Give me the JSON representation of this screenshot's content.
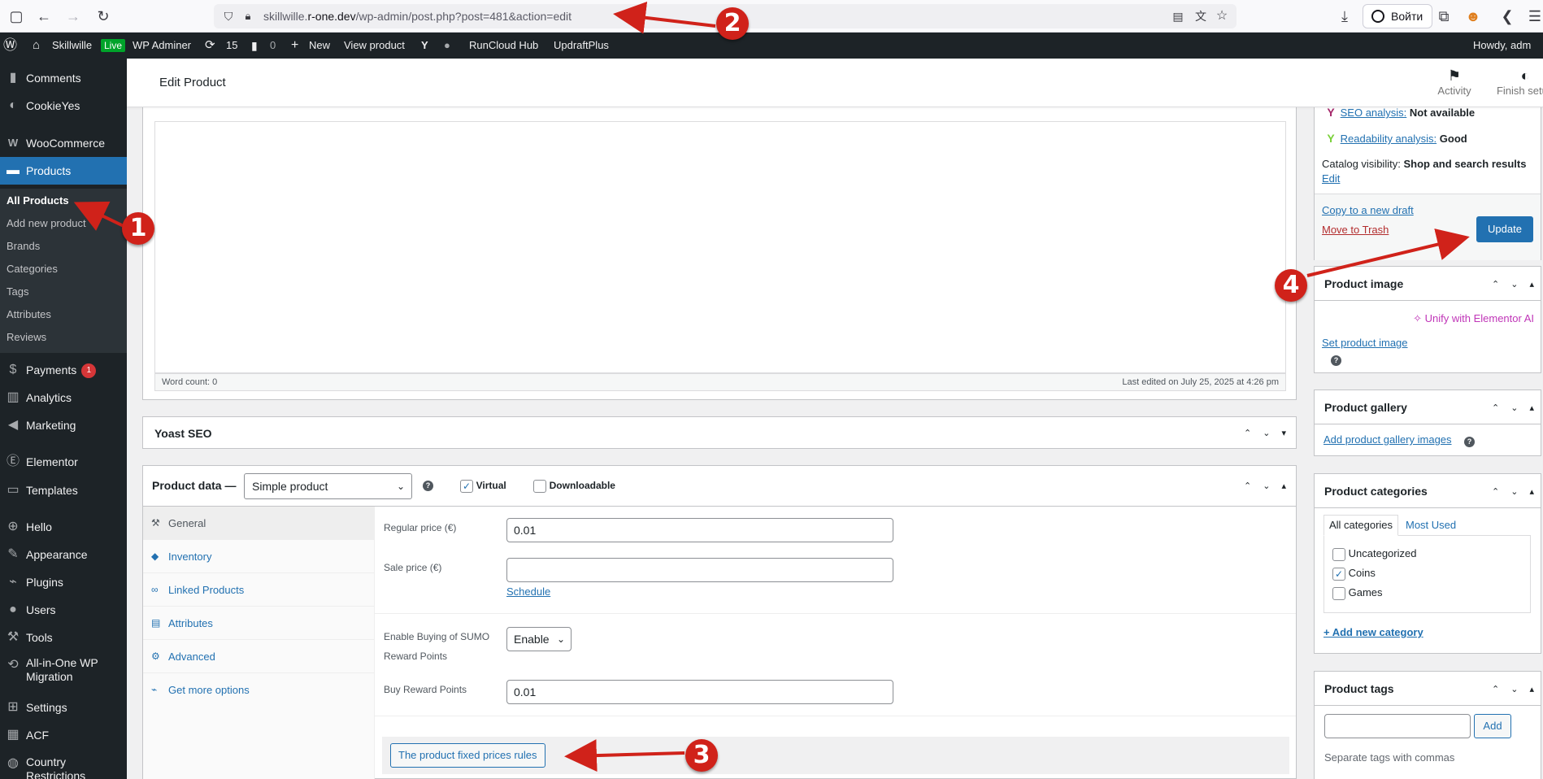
{
  "browser": {
    "url_prefix": "skillwille.",
    "url_domain": "r-one.dev",
    "url_path": "/wp-admin/post.php?post=481&action=edit",
    "login_label": "Войти"
  },
  "adminbar": {
    "site": "Skillwille",
    "live": "Live",
    "wp_adminer": "WP Adminer",
    "updates": "15",
    "comments": "0",
    "new": "New",
    "view_product": "View product",
    "runcloud": "RunCloud Hub",
    "updraft": "UpdraftPlus",
    "howdy": "Howdy, adm"
  },
  "sidebar": {
    "comments": "Comments",
    "cookieyes": "CookieYes",
    "woocommerce": "WooCommerce",
    "products": "Products",
    "sub": [
      "All Products",
      "Add new product",
      "Brands",
      "Categories",
      "Tags",
      "Attributes",
      "Reviews"
    ],
    "payments": "Payments",
    "payments_badge": "1",
    "analytics": "Analytics",
    "marketing": "Marketing",
    "elementor": "Elementor",
    "templates": "Templates",
    "hello": "Hello",
    "appearance": "Appearance",
    "plugins": "Plugins",
    "users": "Users",
    "tools": "Tools",
    "allinone_1": "All-in-One WP",
    "allinone_2": "Migration",
    "settings": "Settings",
    "acf": "ACF",
    "country_1": "Country",
    "country_2": "Restrictions"
  },
  "header": {
    "title": "Edit Product",
    "activity": "Activity",
    "finish": "Finish setup"
  },
  "editor": {
    "word_count": "Word count: 0",
    "last_edited": "Last edited on July 25, 2025 at 4:26 pm"
  },
  "yoast": {
    "title": "Yoast SEO"
  },
  "product_data": {
    "title": "Product data —",
    "type": "Simple product",
    "virtual": "Virtual",
    "downloadable": "Downloadable",
    "tabs": [
      "General",
      "Inventory",
      "Linked Products",
      "Attributes",
      "Advanced",
      "Get more options"
    ],
    "regular_price_label": "Regular price (€)",
    "regular_price": "0.01",
    "sale_price_label": "Sale price (€)",
    "sale_price": "",
    "schedule": "Schedule",
    "sumo_label_1": "Enable Buying of SUMO",
    "sumo_label_2": "Reward Points",
    "sumo_value": "Enable",
    "buy_points_label": "Buy Reward Points",
    "buy_points": "0.01",
    "fixed_prices": "The product fixed prices rules"
  },
  "publish": {
    "seo_label": "SEO analysis:",
    "seo_value": "Not available",
    "read_label": "Readability analysis:",
    "read_value": "Good",
    "visibility_label": "Catalog visibility:",
    "visibility_value": "Shop and search results",
    "edit": "Edit",
    "copy_draft": "Copy to a new draft",
    "trash": "Move to Trash",
    "update": "Update"
  },
  "product_image": {
    "title": "Product image",
    "unify": "Unify with Elementor AI",
    "set": "Set product image"
  },
  "gallery": {
    "title": "Product gallery",
    "add": "Add product gallery images"
  },
  "categories": {
    "title": "Product categories",
    "tab_all": "All categories",
    "tab_used": "Most Used",
    "items": [
      "Uncategorized",
      "Coins",
      "Games"
    ],
    "add_new": "+ Add new category"
  },
  "tags": {
    "title": "Product tags",
    "add": "Add",
    "hint": "Separate tags with commas"
  },
  "callouts": [
    "1",
    "2",
    "3",
    "4"
  ],
  "colors": {
    "accent": "#2271b1",
    "adminbar": "#1d2327",
    "callout": "#d0221a"
  }
}
